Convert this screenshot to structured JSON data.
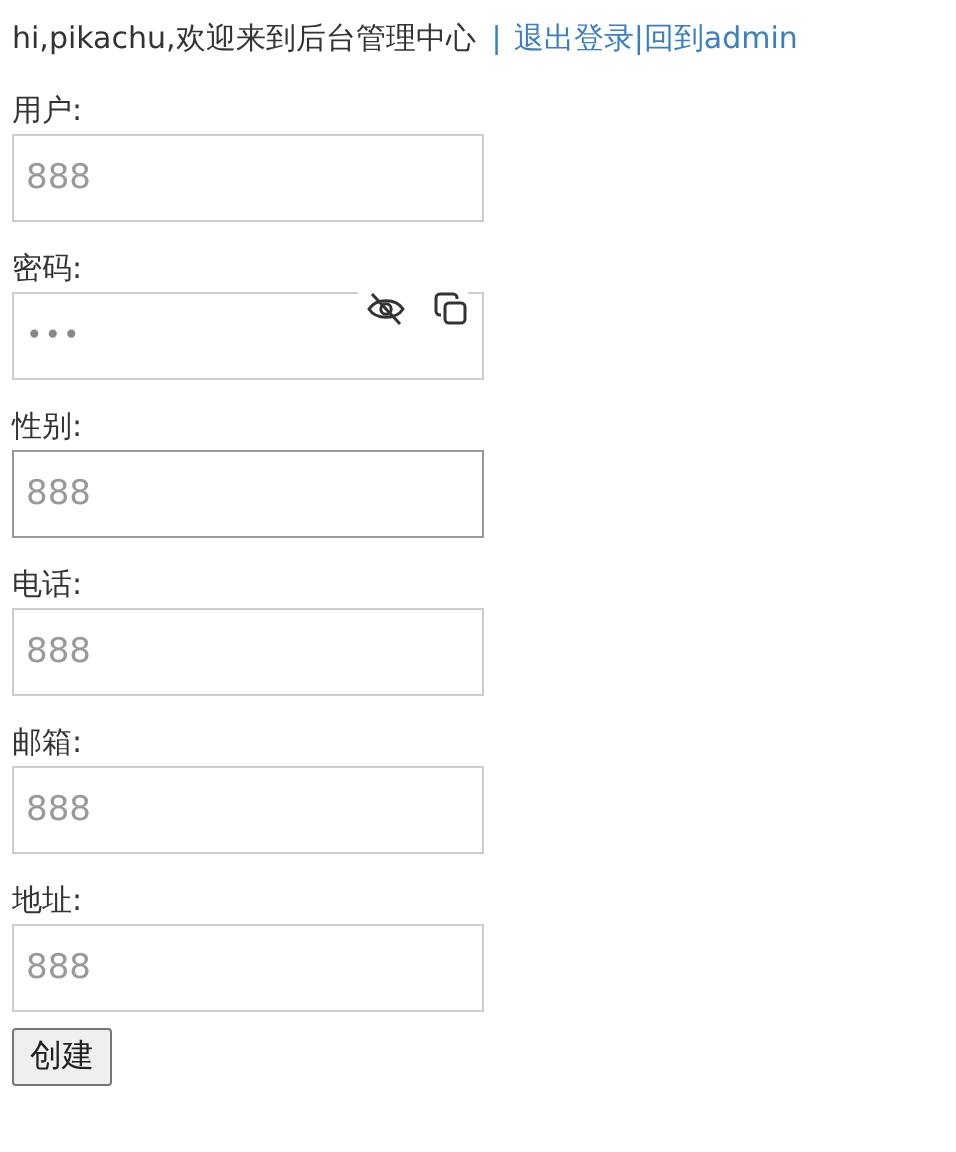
{
  "header": {
    "greeting": "hi,pikachu,欢迎来到后台管理中心",
    "separator": "|",
    "links": [
      {
        "label": "退出登录"
      },
      {
        "label": "|回到admin"
      }
    ]
  },
  "fields": [
    {
      "label": "用户:",
      "kind": "text",
      "placeholder": "888",
      "focused": false
    },
    {
      "label": "密码:",
      "kind": "password",
      "value": "•••",
      "focused": false
    },
    {
      "label": "性别:",
      "kind": "text",
      "placeholder": "888",
      "focused": true
    },
    {
      "label": "电话:",
      "kind": "text",
      "placeholder": "888",
      "focused": false
    },
    {
      "label": "邮箱:",
      "kind": "text",
      "placeholder": "888",
      "focused": false
    },
    {
      "label": "地址:",
      "kind": "text",
      "placeholder": "888",
      "focused": false
    }
  ],
  "submit": {
    "label": "创建"
  }
}
